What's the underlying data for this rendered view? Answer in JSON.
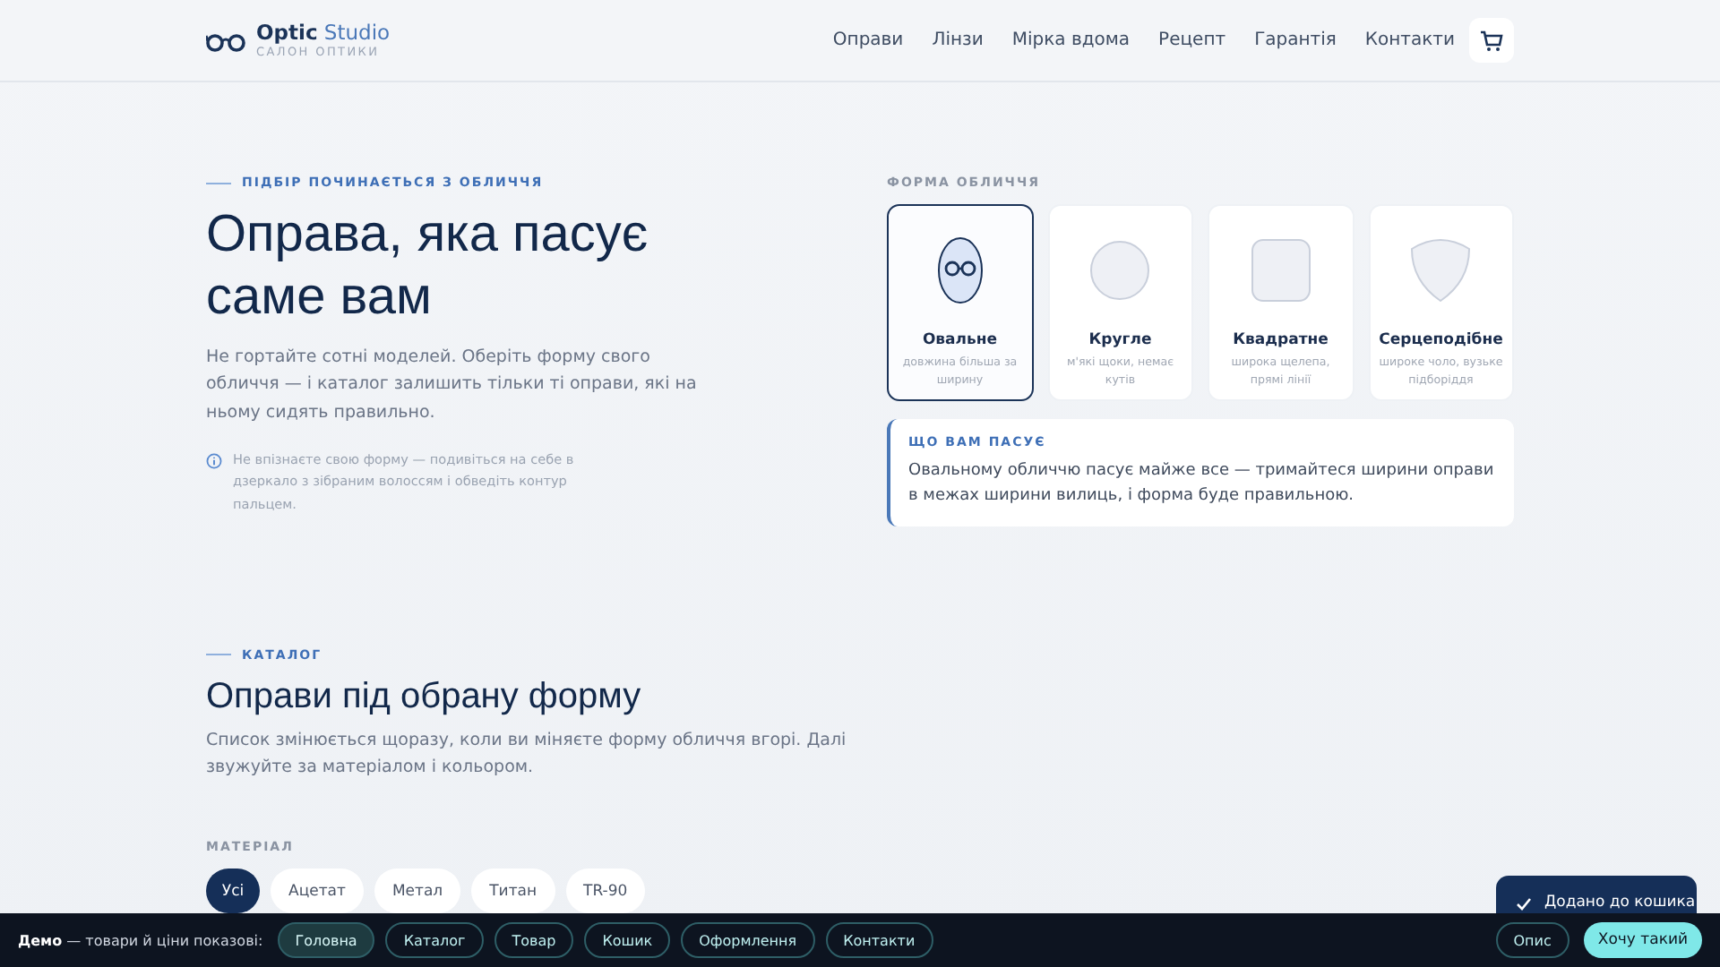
{
  "header": {
    "logo_primary": "Optic",
    "logo_secondary": "Studio",
    "tagline": "САЛОН ОПТИКИ",
    "nav": [
      {
        "label": "Оправи"
      },
      {
        "label": "Лінзи"
      },
      {
        "label": "Мірка вдома"
      },
      {
        "label": "Рецепт"
      },
      {
        "label": "Гарантія"
      },
      {
        "label": "Контакти"
      }
    ]
  },
  "hero": {
    "eyebrow": "ПІДБІР ПОЧИНАЄТЬСЯ З ОБЛИЧЧЯ",
    "title": "Оправа, яка пасує саме вам",
    "lead": "Не гортайте сотні моделей. Оберіть форму свого обличчя — і каталог залишить тільки ті оправи, які на ньому сидять правильно.",
    "hint": "Не впізнаєте свою форму — подивіться на себе в дзеркало з зібраним волоссям і обведіть контур пальцем."
  },
  "face_shape": {
    "label": "ФОРМА ОБЛИЧЧЯ",
    "options": [
      {
        "kind": "oval",
        "name": "Овальне",
        "desc": "довжина більша за ширину",
        "selected": true
      },
      {
        "kind": "round",
        "name": "Кругле",
        "desc": "м'які щоки, немає кутів",
        "selected": false
      },
      {
        "kind": "square",
        "name": "Квадратне",
        "desc": "широка щелепа, прямі лінії",
        "selected": false
      },
      {
        "kind": "heart",
        "name": "Серцеподібне",
        "desc": "широке чоло, вузьке підборіддя",
        "selected": false
      }
    ],
    "advice_title": "ЩО ВАМ ПАСУЄ",
    "advice": "Овальному обличчю пасує майже все — тримайтеся ширини оправи в межах ширини вилиць, і форма буде правильною."
  },
  "catalog": {
    "eyebrow": "КАТАЛОГ",
    "title": "Оправи під обрану форму",
    "lead": "Список змінюється щоразу, коли ви міняєте форму обличчя вгорі. Далі звужуйте за матеріалом і кольором.",
    "filter_label": "МАТЕРІАЛ",
    "materials": [
      {
        "label": "Усі",
        "selected": true
      },
      {
        "label": "Ацетат",
        "selected": false
      },
      {
        "label": "Метал",
        "selected": false
      },
      {
        "label": "Титан",
        "selected": false
      },
      {
        "label": "TR-90",
        "selected": false
      }
    ]
  },
  "toast": {
    "text": "Додано до кошика"
  },
  "demo_bar": {
    "label_bold": "Демо",
    "label": "— товари й ціни показові:",
    "links": [
      {
        "label": "Головна",
        "selected": true
      },
      {
        "label": "Каталог",
        "selected": false
      },
      {
        "label": "Товар",
        "selected": false
      },
      {
        "label": "Кошик",
        "selected": false
      },
      {
        "label": "Оформлення",
        "selected": false
      },
      {
        "label": "Контакти",
        "selected": false
      }
    ],
    "secondary": "Опис",
    "primary": "Хочу такий"
  }
}
